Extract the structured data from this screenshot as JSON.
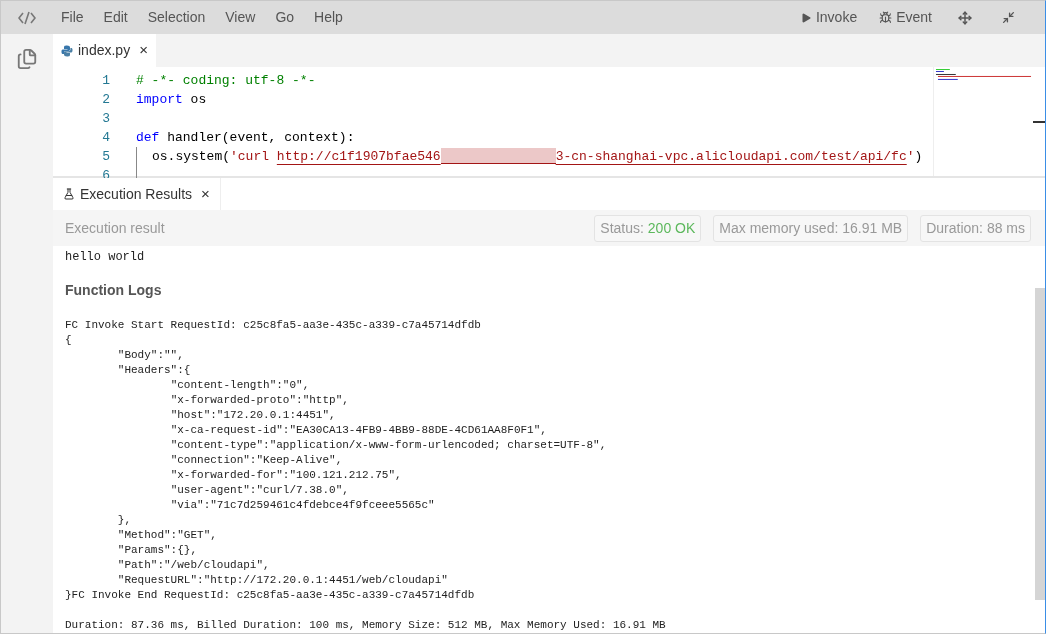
{
  "menu": [
    "File",
    "Edit",
    "Selection",
    "View",
    "Go",
    "Help"
  ],
  "toolbar": [
    {
      "kind": "invoke",
      "label": "Invoke"
    },
    {
      "kind": "event",
      "label": "Event"
    },
    {
      "kind": "move"
    },
    {
      "kind": "collapse"
    }
  ],
  "editor_tabs": [
    {
      "label": "index.py",
      "close": "×",
      "selected": true
    }
  ],
  "code_lines": [
    {
      "number": "1",
      "indent": false,
      "tokens": [
        {
          "kind": "comment",
          "text": "# -*- coding: utf-8 -*-"
        }
      ]
    },
    {
      "number": "2",
      "indent": false,
      "tokens": [
        {
          "kind": "keyword",
          "text": "import"
        },
        {
          "kind": "plain",
          "text": " os"
        }
      ]
    },
    {
      "number": "3",
      "indent": false
    },
    {
      "number": "4",
      "indent": false,
      "tokens": [
        {
          "kind": "keyword",
          "text": "def"
        },
        {
          "kind": "plain",
          "text": " handler(event, context):"
        }
      ]
    },
    {
      "number": "5",
      "indent": true,
      "tokens": [
        {
          "kind": "plain",
          "text": "os.system("
        },
        {
          "kind": "string",
          "text": "'curl "
        },
        {
          "kind": "link",
          "text": "http://c1f1907bfae546"
        },
        {
          "kind": "redacted"
        },
        {
          "kind": "link",
          "text": "3-cn-shanghai-vpc.alicloudapi.com/test/api/fc"
        },
        {
          "kind": "string",
          "text": "'"
        },
        {
          "kind": "plain",
          "text": ")"
        }
      ]
    },
    {
      "number": "6",
      "indent": true
    }
  ],
  "panel_tabs": [
    {
      "label": "Execution Results",
      "close": "×",
      "selected": true
    }
  ],
  "result": {
    "title": "Execution result",
    "badges": [
      {
        "label": "Status:",
        "value": "200 OK",
        "color": "#5cb85c"
      },
      {
        "label": "Max memory used:",
        "value": "16.91 MB",
        "color": "#999999"
      },
      {
        "label": "Duration:",
        "value": "88 ms",
        "color": "#999999"
      }
    ],
    "output": "hello world",
    "logs_title": "Function Logs",
    "log_blocks": [
      [
        "FC Invoke Start RequestId: c25c8fa5-aa3e-435c-a339-c7a45714dfdb",
        "{",
        "\t\"Body\":\"\",",
        "\t\"Headers\":{",
        "\t\t\"content-length\":\"0\",",
        "\t\t\"x-forwarded-proto\":\"http\",",
        "\t\t\"host\":\"172.20.0.1:4451\",",
        "\t\t\"x-ca-request-id\":\"EA30CA13-4FB9-4BB9-88DE-4CD61AA8F0F1\",",
        "\t\t\"content-type\":\"application/x-www-form-urlencoded; charset=UTF-8\",",
        "\t\t\"connection\":\"Keep-Alive\",",
        "\t\t\"x-forwarded-for\":\"100.121.212.75\",",
        "\t\t\"user-agent\":\"curl/7.38.0\",",
        "\t\t\"via\":\"71c7d259461c4fdebce4f9fceee5565c\"",
        "\t},",
        "\t\"Method\":\"GET\",",
        "\t\"Params\":{},",
        "\t\"Path\":\"/web/cloudapi\",",
        "\t\"RequestURL\":\"http://172.20.0.1:4451/web/cloudapi\"",
        "}FC Invoke End RequestId: c25c8fa5-aa3e-435c-a339-c7a45714dfdb"
      ],
      [
        "Duration: 87.36 ms, Billed Duration: 100 ms, Memory Size: 512 MB, Max Memory Used: 16.91 MB"
      ]
    ]
  }
}
